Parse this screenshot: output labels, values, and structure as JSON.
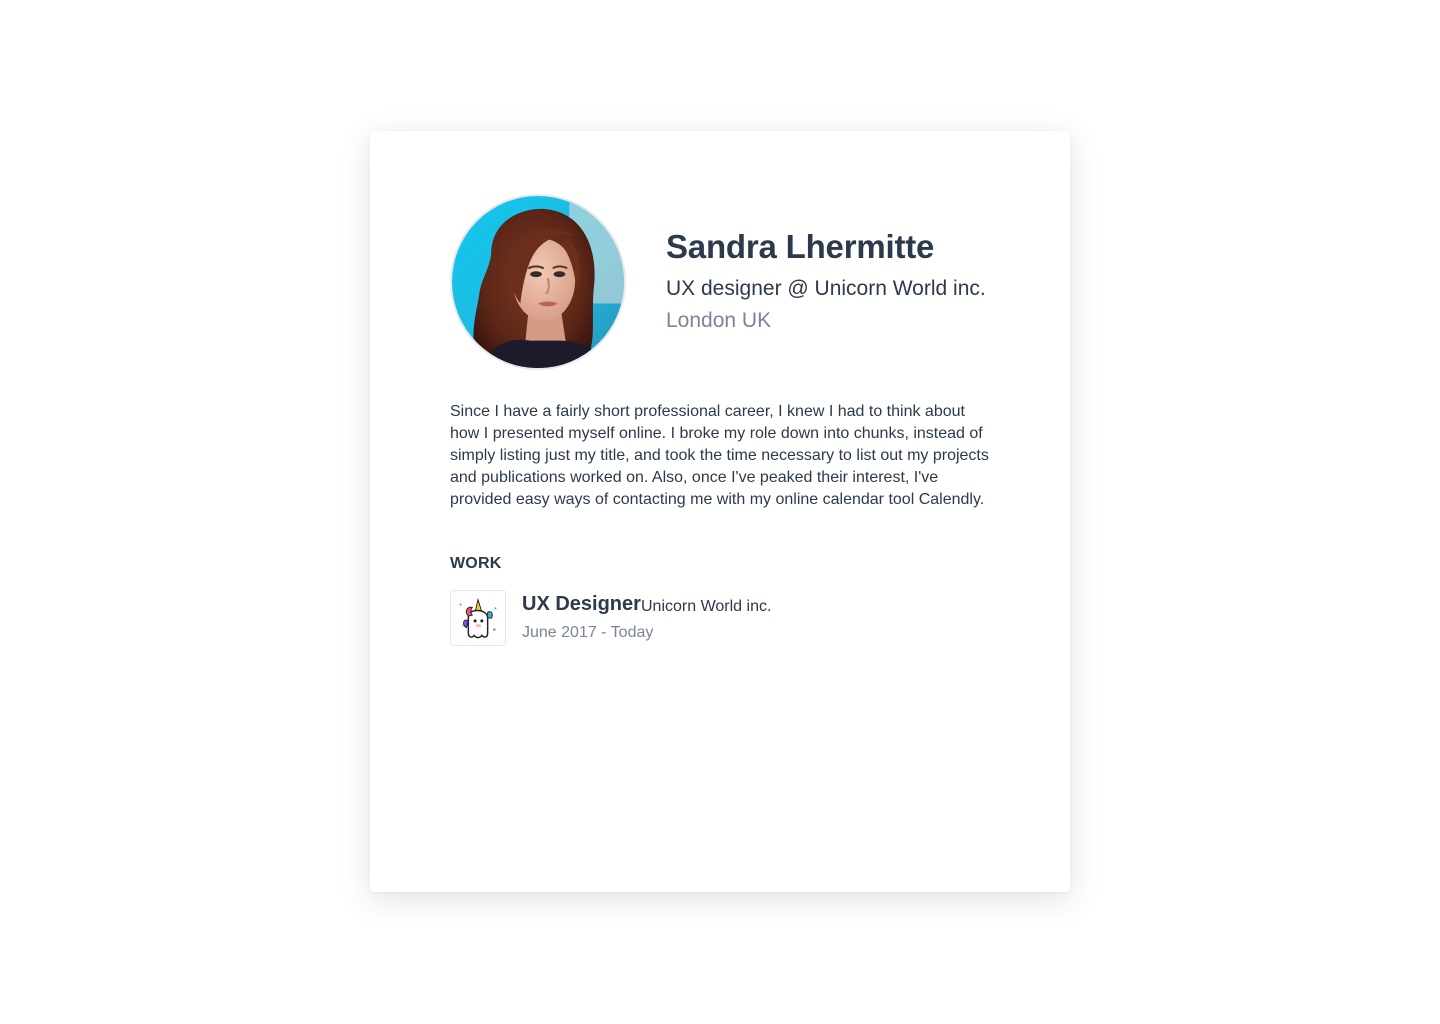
{
  "profile": {
    "name": "Sandra Lhermitte",
    "role": "UX designer @ Unicorn World inc.",
    "location": "London UK",
    "avatar_icon": "profile-photo",
    "bio": "Since I have a fairly short professional career, I knew I had to think about how I presented myself online. I broke my role down into chunks, instead of simply listing just my title, and took the time necessary to list out my projects and publications worked on. Also, once I've peaked their interest, I've provided easy ways of contacting me with my online calendar tool Calendly."
  },
  "work": {
    "section_title": "WORK",
    "jobs": [
      {
        "title": "UX Designer",
        "company": "Unicorn World inc.",
        "dates": "June 2017 - Today",
        "logo_icon": "unicorn-logo"
      }
    ]
  },
  "colors": {
    "text_primary": "#2c3a4b",
    "text_secondary": "#7a8595",
    "avatar_background": "#1ec3e6"
  }
}
